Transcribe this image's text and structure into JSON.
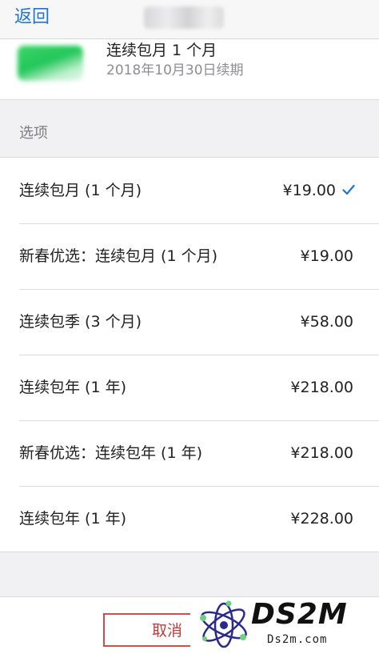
{
  "navbar": {
    "back_label": "返回"
  },
  "subscription": {
    "title": "连续包月 1 个月",
    "renewal_text": "2018年10月30日续期"
  },
  "options_section": {
    "label": "选项",
    "items": [
      {
        "label": "连续包月 (1 个月)",
        "price": "¥19.00",
        "selected": true
      },
      {
        "label": "新春优选：连续包月 (1 个月)",
        "price": "¥19.00",
        "selected": false
      },
      {
        "label": "连续包季 (3 个月)",
        "price": "¥58.00",
        "selected": false
      },
      {
        "label": "连续包年 (1 年)",
        "price": "¥218.00",
        "selected": false
      },
      {
        "label": "新春优选：连续包年 (1 年)",
        "price": "¥218.00",
        "selected": false
      },
      {
        "label": "连续包年 (1 年)",
        "price": "¥228.00",
        "selected": false
      }
    ]
  },
  "bottom": {
    "cancel_label": "取消"
  },
  "watermark": {
    "brand": "DS2M",
    "domain": "Ds2m.com"
  },
  "colors": {
    "accent_blue": "#1d73d8",
    "cancel_red": "#d64a4a",
    "secondary_text": "#8e8e93",
    "group_background": "#f1f1f3"
  },
  "icons": {
    "selected_marker": "checkmark-icon"
  }
}
